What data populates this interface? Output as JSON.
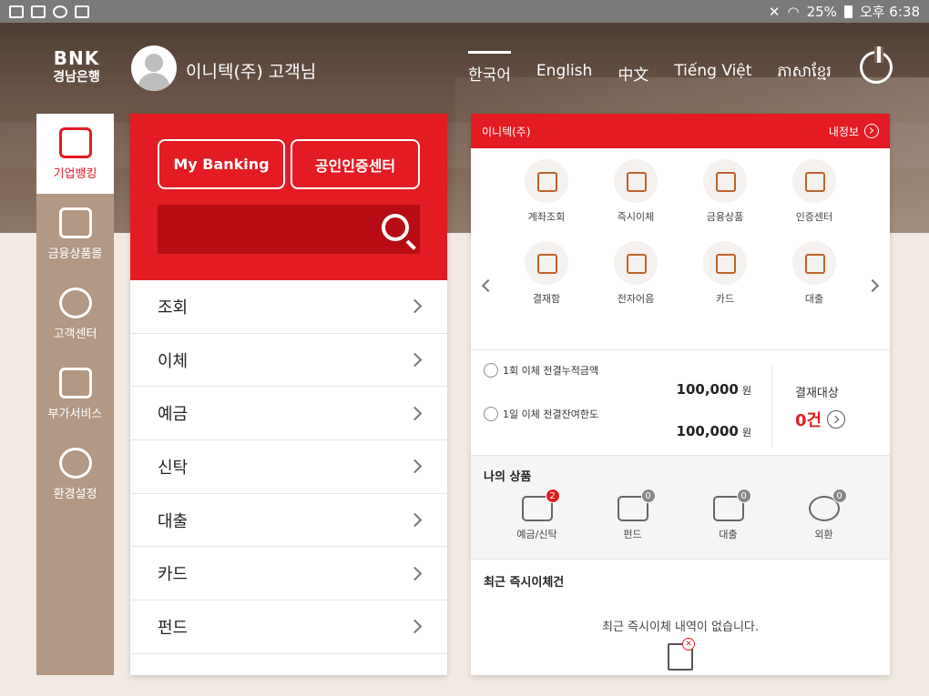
{
  "status_bar": {
    "battery": "25%",
    "time": "오후 6:38",
    "icons": [
      "gallery-icon",
      "data-icon",
      "sync-icon",
      "download-icon",
      "mute-icon",
      "wifi-icon",
      "battery-icon"
    ]
  },
  "header": {
    "logo_top": "BNK",
    "logo_bottom": "경남은행",
    "username": "이니텍(주) 고객님",
    "languages": [
      "한국어",
      "English",
      "中文",
      "Tiếng Việt",
      "ភាសាខ្មែរ"
    ],
    "active_language": "한국어"
  },
  "leftnav": {
    "items": [
      {
        "label": "기업뱅킹",
        "icon": "building-icon"
      },
      {
        "label": "금융상품몰",
        "icon": "shopping-bag-icon"
      },
      {
        "label": "고객센터",
        "icon": "headset-icon"
      },
      {
        "label": "부가서비스",
        "icon": "coffee-cup-icon"
      },
      {
        "label": "환경설정",
        "icon": "gear-icon"
      }
    ]
  },
  "menu": {
    "my_banking": "My Banking",
    "cert_center": "공인인증센터",
    "search_placeholder": "",
    "items": [
      "조회",
      "이체",
      "예금",
      "신탁",
      "대출",
      "카드",
      "펀드"
    ]
  },
  "account": {
    "name": "이니텍(주)",
    "my_info": "내정보",
    "quick_menu": [
      {
        "label": "계좌조회",
        "icon": "account-search-icon"
      },
      {
        "label": "즉시이체",
        "icon": "transfer-icon"
      },
      {
        "label": "금융상품",
        "icon": "product-bag-icon"
      },
      {
        "label": "인증센터",
        "icon": "shield-check-icon"
      },
      {
        "label": "결재함",
        "icon": "approval-box-icon"
      },
      {
        "label": "전자어음",
        "icon": "e-bill-icon"
      },
      {
        "label": "카드",
        "icon": "card-icon"
      },
      {
        "label": "대출",
        "icon": "loan-icon"
      }
    ],
    "limit_1": {
      "label": "1회 이체 전결누적금액",
      "value": "100,000",
      "unit": "원"
    },
    "limit_2": {
      "label": "1일 이체 전결잔여한도",
      "value": "100,000",
      "unit": "원"
    },
    "pending_label": "결재대상",
    "pending_count": "0건"
  },
  "my_products": {
    "title": "나의 상품",
    "items": [
      {
        "label": "예금/신탁",
        "count": "2",
        "icon": "piggy-bank-icon"
      },
      {
        "label": "펀드",
        "count": "0",
        "icon": "fund-chart-icon"
      },
      {
        "label": "대출",
        "count": "0",
        "icon": "loan-money-icon"
      },
      {
        "label": "외환",
        "count": "0",
        "icon": "exchange-coins-icon"
      }
    ]
  },
  "recent": {
    "title": "최근 즉시이체건",
    "empty_message": "최근 즉시이체 내역이 없습니다."
  },
  "colors": {
    "brand": "#e31b23",
    "nav_bg": "#b39883"
  }
}
